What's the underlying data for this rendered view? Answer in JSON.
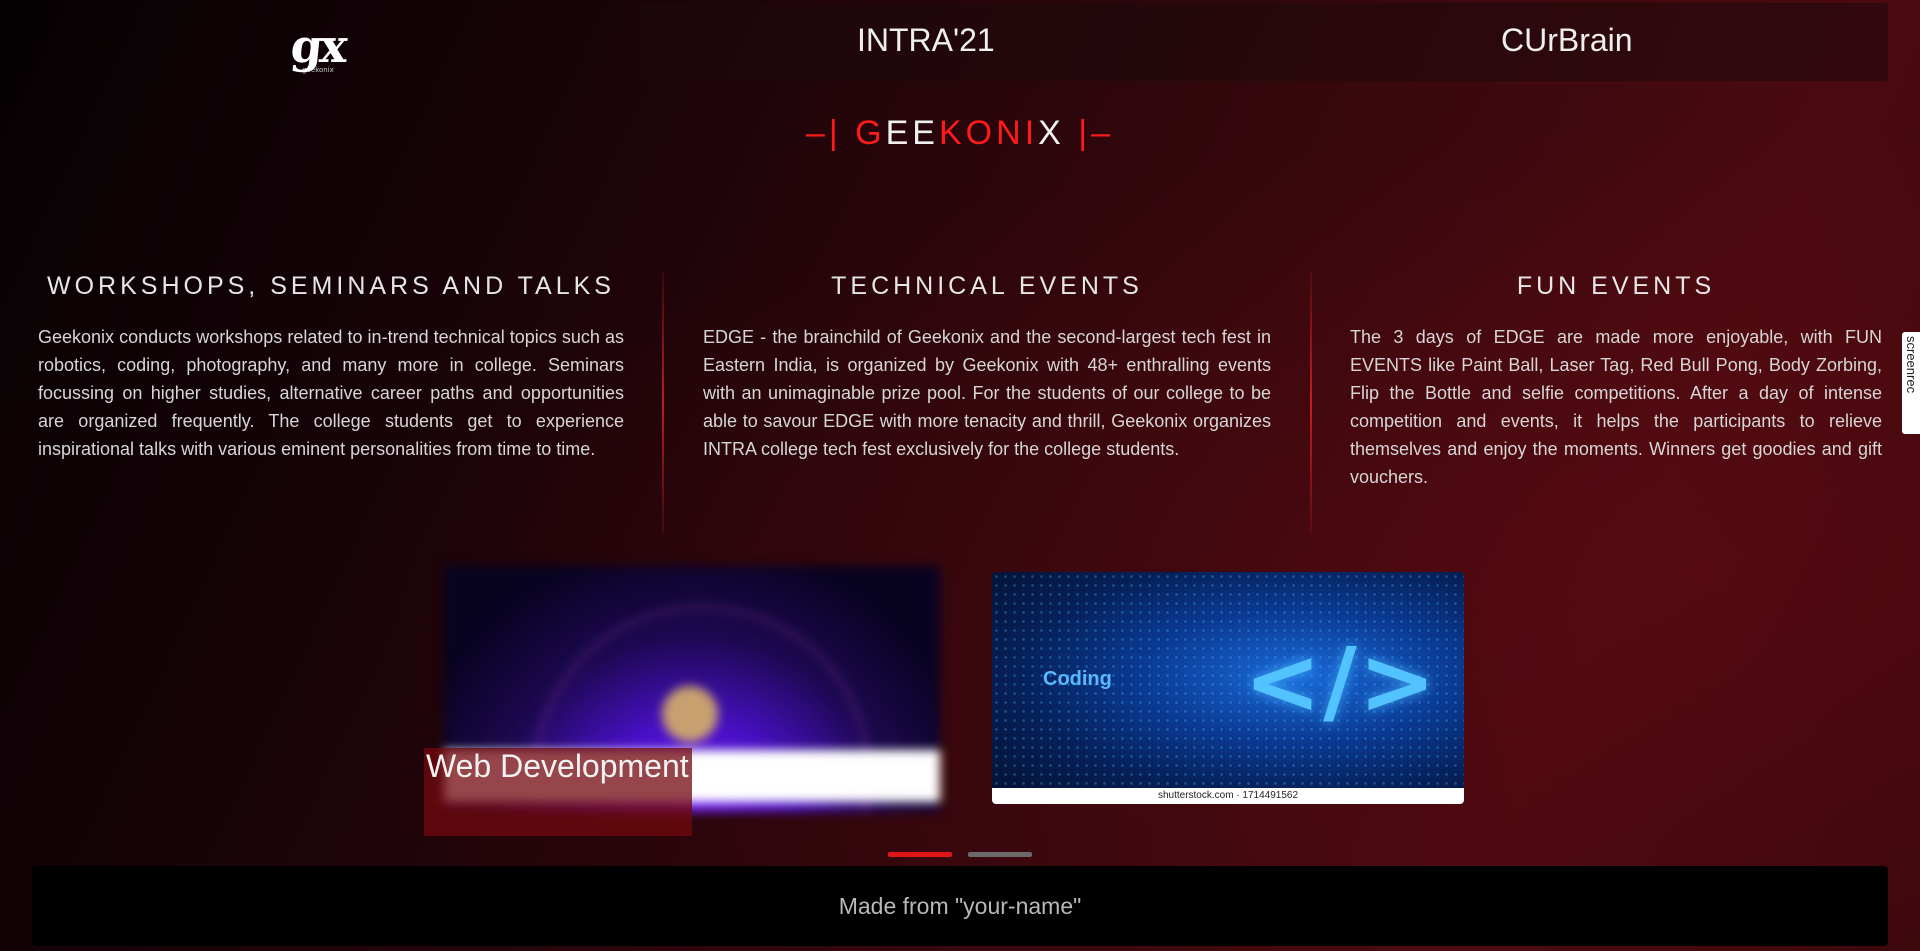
{
  "nav": {
    "logo_mark": "gx",
    "logo_sub": "geekonix",
    "links": [
      "INTRA'21",
      "CUrBrain"
    ]
  },
  "brand": {
    "prefix": "–|",
    "letters": [
      "G",
      "E",
      "E",
      "K",
      "O",
      "N",
      "I",
      "X"
    ],
    "suffix": "|–"
  },
  "sections": [
    {
      "title": "WORKSHOPS, SEMINARS AND TALKS",
      "body": "Geekonix conducts workshops related to in-trend technical topics such as robotics, coding, photography, and many more in college. Seminars focussing on higher studies, alternative career paths and opportunities are organized frequently. The college students get to experience inspirational talks with various eminent personalities from time to time."
    },
    {
      "title": "TECHNICAL EVENTS",
      "body": "EDGE - the brainchild of Geekonix and the second-largest tech fest in Eastern India, is organized by Geekonix with 48+ enthralling events with an unimaginable prize pool. For the students of our college to be able to savour EDGE with more tenacity and thrill, Geekonix organizes INTRA college tech fest exclusively for the college students."
    },
    {
      "title": "FUN EVENTS",
      "body": "The 3 days of EDGE are made more enjoyable, with FUN EVENTS like Paint Ball, Laser Tag, Red Bull Pong, Body Zorbing, Flip the Bottle and selfie competitions. After a day of intense competition and events, it helps the participants to relieve themselves and enjoy the moments. Winners get goodies and gift vouchers."
    }
  ],
  "carousel": {
    "cards": [
      {
        "label": "Web Development"
      },
      {
        "image_text": "Coding",
        "image_icon": "</>",
        "credit": "shutterstock.com · 1714491562"
      }
    ],
    "active_index": 0,
    "indicator_count": 2
  },
  "footer": {
    "text": "Made from \"your-name\""
  },
  "overlay": {
    "screenrec_label": "screenrec"
  },
  "colors": {
    "accent_red": "#ff1a1a",
    "indicator_active": "#e01515",
    "indicator_inactive": "#6a6a6a"
  }
}
